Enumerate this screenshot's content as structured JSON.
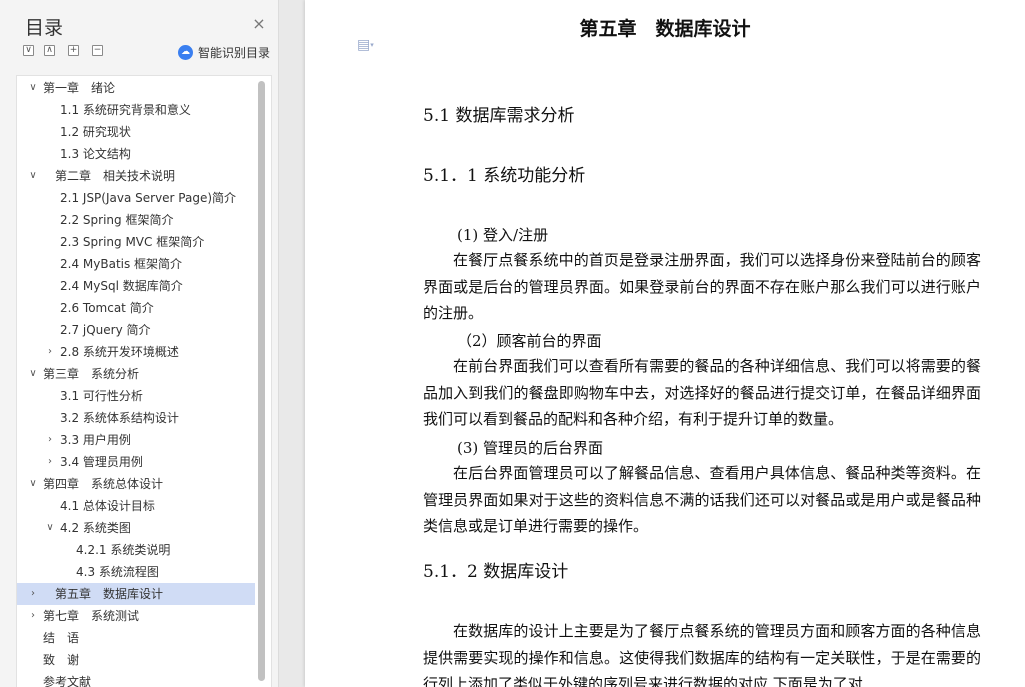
{
  "toc": {
    "title": "目录",
    "close_icon": "×",
    "tools": [
      {
        "name": "collapse-all",
        "glyph": "∨"
      },
      {
        "name": "expand-all",
        "glyph": "∧"
      },
      {
        "name": "add-heading",
        "glyph": "+"
      },
      {
        "name": "remove-heading",
        "glyph": "−"
      }
    ],
    "smart_label": "智能识别目录",
    "items": [
      {
        "label": "第一章　绪论",
        "level": 1,
        "arrow": "∨"
      },
      {
        "label": "1.1 系统研究背景和意义",
        "level": 2
      },
      {
        "label": "1.2 研究现状",
        "level": 2
      },
      {
        "label": "1.3 论文结构",
        "level": 2
      },
      {
        "label": "　第二章　相关技术说明",
        "level": 1,
        "arrow": "∨"
      },
      {
        "label": "2.1 JSP(Java Server Page)简介",
        "level": 2
      },
      {
        "label": "2.2 Spring 框架简介",
        "level": 2
      },
      {
        "label": "2.3 Spring MVC 框架简介",
        "level": 2
      },
      {
        "label": "2.4 MyBatis  框架简介",
        "level": 2
      },
      {
        "label": "2.4 MySql 数据库简介",
        "level": 2
      },
      {
        "label": "2.6 Tomcat 简介",
        "level": 2
      },
      {
        "label": "2.7 jQuery 简介",
        "level": 2
      },
      {
        "label": "2.8 系统开发环境概述",
        "level": 2,
        "arrow": "›"
      },
      {
        "label": "第三章　系统分析",
        "level": 1,
        "arrow": "∨"
      },
      {
        "label": "3.1 可行性分析",
        "level": 2
      },
      {
        "label": "3.2 系统体系结构设计",
        "level": 2
      },
      {
        "label": "3.3 用户用例",
        "level": 2,
        "arrow": "›"
      },
      {
        "label": "3.4 管理员用例",
        "level": 2,
        "arrow": "›"
      },
      {
        "label": "第四章　系统总体设计",
        "level": 1,
        "arrow": "∨"
      },
      {
        "label": "4.1 总体设计目标",
        "level": 2
      },
      {
        "label": "4.2 系统类图",
        "level": 2,
        "arrow": "∨"
      },
      {
        "label": "4.2.1 系统类说明",
        "level": 3
      },
      {
        "label": "4.3 系统流程图",
        "level": 3
      },
      {
        "label": "　第五章　数据库设计",
        "level": 1,
        "arrow": "›",
        "active": true
      },
      {
        "label": "第七章　系统测试",
        "level": 1,
        "arrow": "›"
      },
      {
        "label": "结　语",
        "level": 1
      },
      {
        "label": "致　谢",
        "level": 1
      },
      {
        "label": "参考文献",
        "level": 1
      }
    ]
  },
  "document": {
    "page_icon": "▤",
    "page_icon_caret": "▾",
    "chapter_title": "第五章　数据库设计",
    "h_5_1": "5.1 数据库需求分析",
    "h_5_1_1": "5.1．1 系统功能分析",
    "sub1": "(1) 登入/注册",
    "p1": "在餐厅点餐系统中的首页是登录注册界面，我们可以选择身份来登陆前台的顾客界面或是后台的管理员界面。如果登录前台的界面不存在账户那么我们可以进行账户的注册。",
    "sub2": "（2）顾客前台的界面",
    "p2": "在前台界面我们可以查看所有需要的餐品的各种详细信息、我们可以将需要的餐品加入到我们的餐盘即购物车中去，对选择好的餐品进行提交订单，在餐品详细界面我们可以看到餐品的配料和各种介绍，有利于提升订单的数量。",
    "sub3": "(3) 管理员的后台界面",
    "p3": "在后台界面管理员可以了解餐品信息、查看用户具体信息、餐品种类等资料。在管理员界面如果对于这些的资料信息不满的话我们还可以对餐品或是用户或是餐品种类信息或是订单进行需要的操作。",
    "h_5_1_2": "5.1．2 数据库设计",
    "p4": "在数据库的设计上主要是为了餐厅点餐系统的管理员方面和顾客方面的各种信息提供需要实现的操作和信息。这使得我们数据库的结构有一定关联性，于是在需要的行列上添加了类似于外键的序列号来进行数据的对应,下面是为了对"
  },
  "colors": {
    "active_row": "#d0dcf5",
    "smart_icon": "#3a7ff0"
  }
}
